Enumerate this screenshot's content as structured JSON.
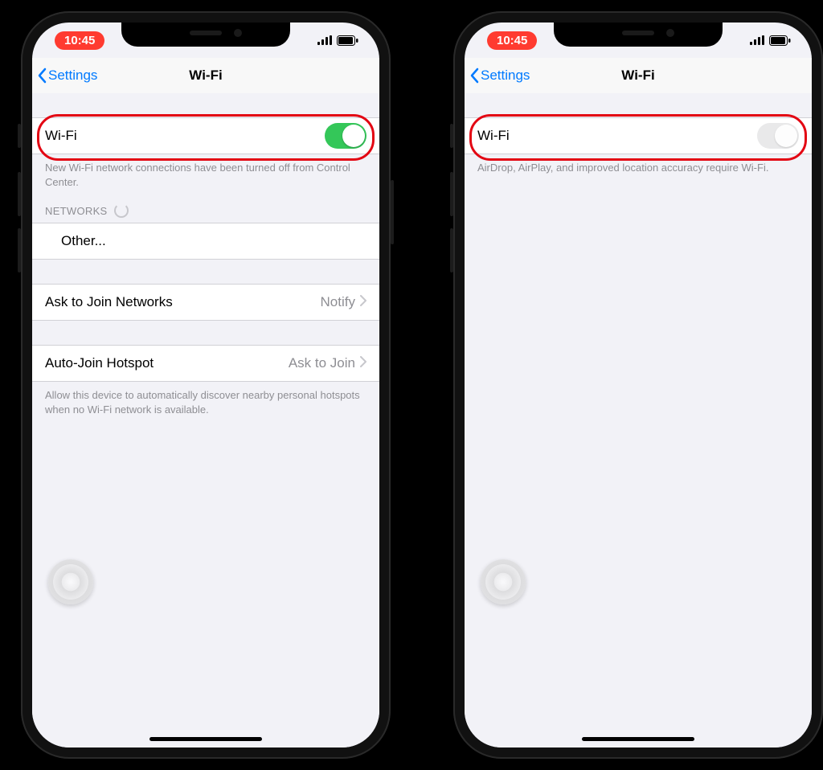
{
  "status": {
    "time": "10:45"
  },
  "nav": {
    "back_label": "Settings",
    "title": "Wi-Fi"
  },
  "left_phone": {
    "wifi_label": "Wi-Fi",
    "wifi_on": true,
    "note": "New Wi-Fi network connections have been turned off from Control Center.",
    "networks_header": "NETWORKS",
    "other_label": "Other...",
    "ask_label": "Ask to Join Networks",
    "ask_value": "Notify",
    "auto_label": "Auto-Join Hotspot",
    "auto_value": "Ask to Join",
    "auto_footer": "Allow this device to automatically discover nearby personal hotspots when no Wi-Fi network is available."
  },
  "right_phone": {
    "wifi_label": "Wi-Fi",
    "wifi_on": false,
    "note": "AirDrop, AirPlay, and improved location accuracy require Wi-Fi."
  },
  "colors": {
    "accent_blue": "#007aff",
    "toggle_green": "#34c759",
    "highlight_red": "#e30613",
    "time_pill_red": "#ff3b30"
  }
}
